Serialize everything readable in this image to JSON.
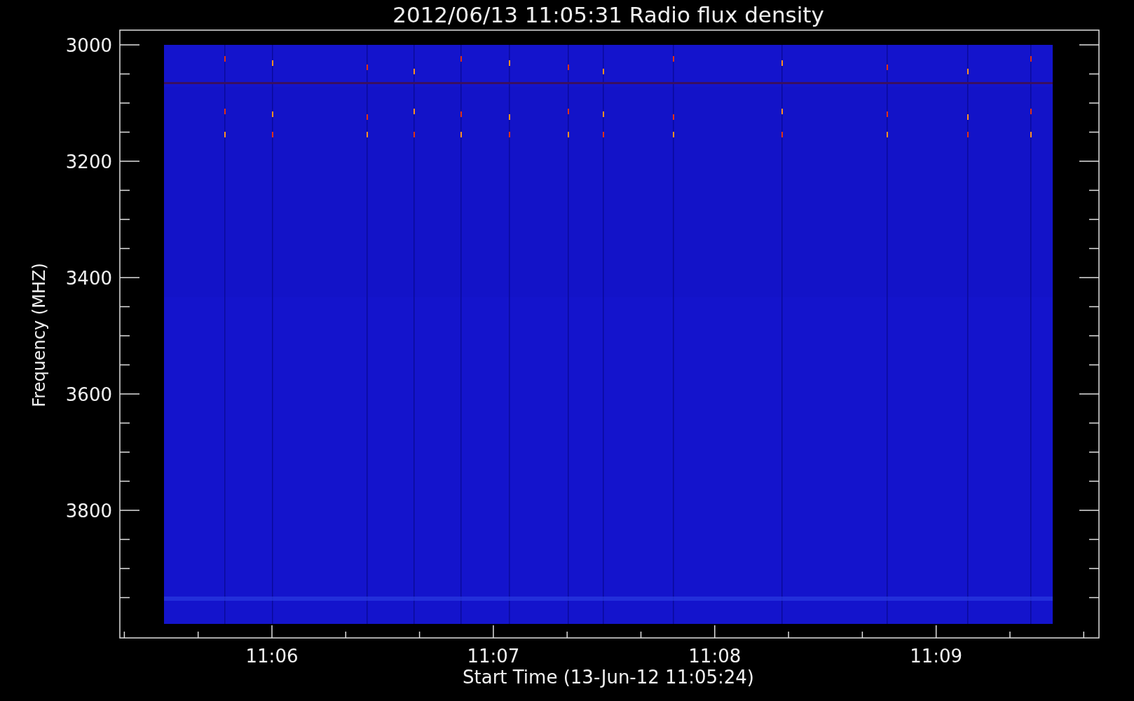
{
  "plot": {
    "title": "2012/06/13 11:05:31 Radio flux density",
    "y_axis": {
      "label": "Frequency (MHZ)",
      "ticks": [
        "3000",
        "3200",
        "3400",
        "3600",
        "3800"
      ]
    },
    "x_axis": {
      "label": "Start Time (13-Jun-12 11:05:24)",
      "ticks": [
        "11:06",
        "11:07",
        "11:08",
        "11:09"
      ]
    }
  }
}
